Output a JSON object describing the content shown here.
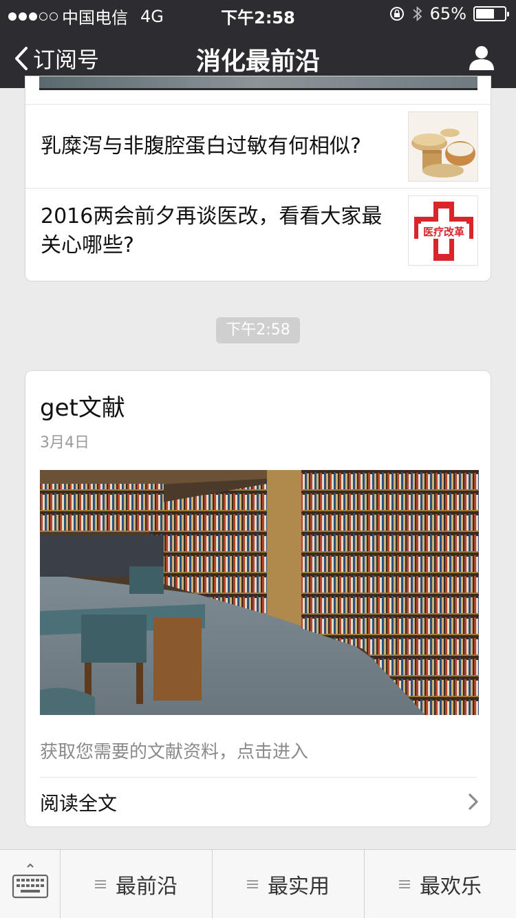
{
  "status_bar": {
    "carrier": "中国电信",
    "network": "4G",
    "time": "下午2:58",
    "battery": "65%",
    "battery_level": 0.65
  },
  "nav": {
    "back_label": "订阅号",
    "title": "消化最前沿"
  },
  "articles": [
    {
      "title": "乳糜泻与非腹腔蛋白过敏有何相似?",
      "thumb_icon": "grains-photo"
    },
    {
      "title": "2016两会前夕再谈医改，看看大家最关心哪些?",
      "thumb_icon": "medical-reform-logo",
      "thumb_text": "医疗改革"
    }
  ],
  "message_time": "下午2:58",
  "main_card": {
    "title": "get文献",
    "date": "3月4日",
    "image_icon": "library-photo",
    "description": "获取您需要的文献资料，点击进入",
    "read_all": "阅读全文"
  },
  "menu": {
    "items": [
      {
        "label": "最前沿"
      },
      {
        "label": "最实用"
      },
      {
        "label": "最欢乐"
      }
    ]
  },
  "colors": {
    "topbar": "#2d2d31",
    "background": "#ebebeb",
    "reform_red": "#d9262c"
  }
}
